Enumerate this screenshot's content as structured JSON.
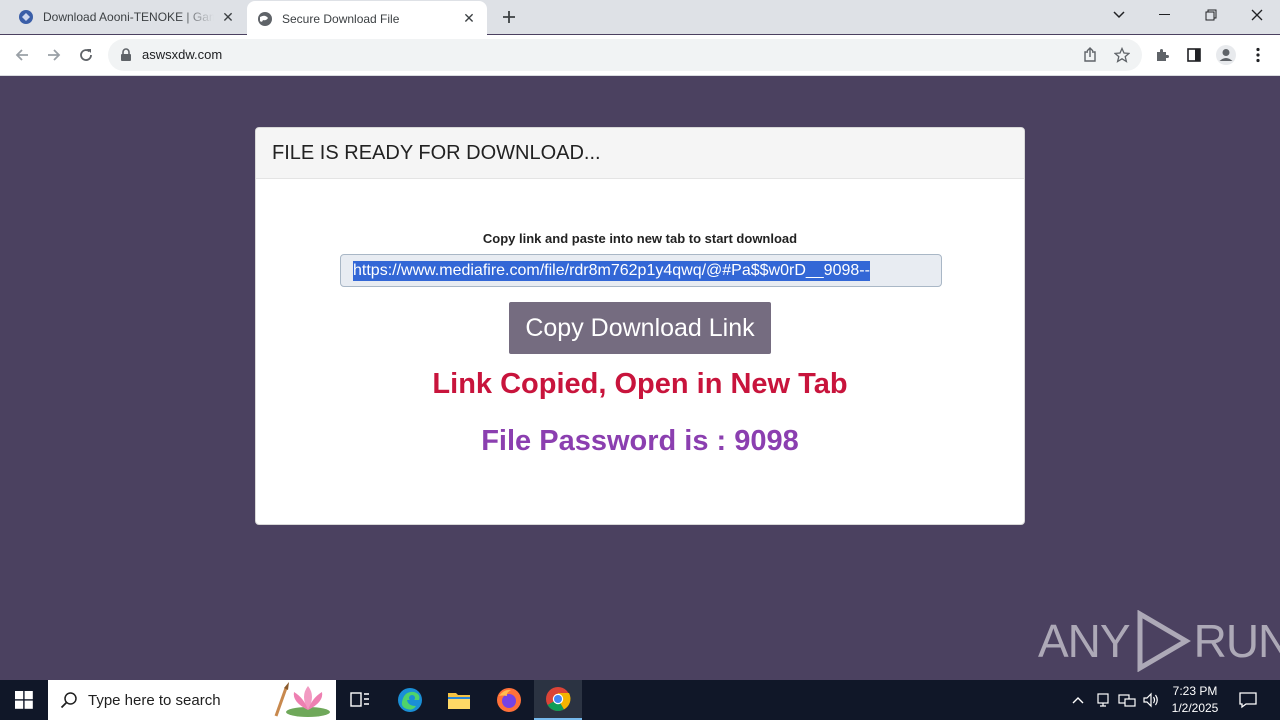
{
  "browser": {
    "tabs": [
      {
        "title": "Download Aooni-TENOKE | Gam",
        "active": false
      },
      {
        "title": "Secure Download File",
        "active": true
      }
    ],
    "address": "aswsxdw.com"
  },
  "page": {
    "card_title": "FILE IS READY FOR DOWNLOAD...",
    "instruction": "Copy link and paste into new tab to start download",
    "link_value": "https://www.mediafire.com/file/rdr8m762p1y4qwq/@#Pa$$w0rD__9098--",
    "copy_button_label": "Copy Download Link",
    "copied_message": "Link Copied, Open in New Tab",
    "password_message": "File Password is : 9098"
  },
  "watermark": "ANY RUN",
  "taskbar": {
    "search_placeholder": "Type here to search",
    "time": "7:23 PM",
    "date": "1/2/2025"
  },
  "colors": {
    "page_background": "#4b4160",
    "copied_text": "#c8143c",
    "password_text": "#8b3fb0",
    "button_background": "#756c80",
    "selection": "#3367d6"
  }
}
